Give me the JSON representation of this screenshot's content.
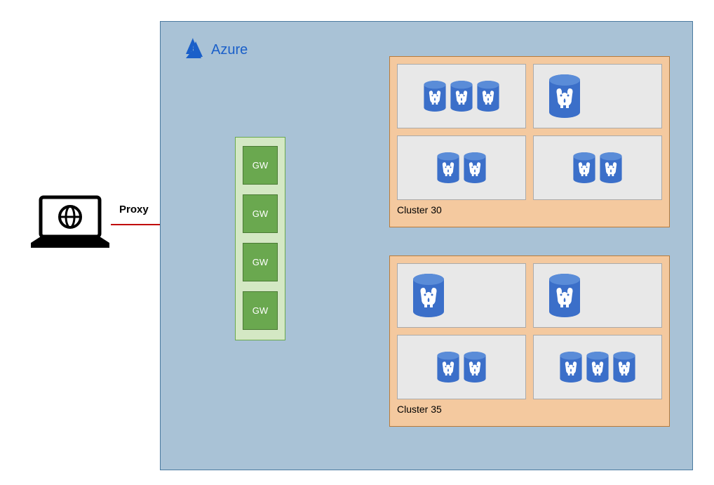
{
  "proxy_label": "Proxy",
  "azure_label": "Azure",
  "gateways": [
    "GW",
    "GW",
    "GW",
    "GW"
  ],
  "clusters": [
    {
      "id": "cluster-30",
      "label": "Cluster 30",
      "cells": [
        3,
        1,
        2,
        2
      ]
    },
    {
      "id": "cluster-35",
      "label": "Cluster 35",
      "cells": [
        1,
        1,
        2,
        3
      ]
    }
  ],
  "colors": {
    "azure_bg": "#a9c2d6",
    "gw_bg": "#6aa84f",
    "cluster_bg": "#f4c99f",
    "db_fill": "#3b6fc9",
    "connection": "#c00000"
  }
}
